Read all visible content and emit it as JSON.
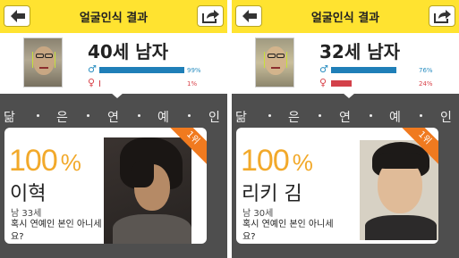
{
  "panels": [
    {
      "header": {
        "title": "얼굴인식 결과"
      },
      "profile": {
        "title": "40세 남자",
        "male_symbol": "♂",
        "female_symbol": "♀",
        "male_pct": "99%",
        "female_pct": "1%",
        "male_fraction": 0.99,
        "female_fraction": 0.01
      },
      "strip": {
        "title_chars": [
          "닮",
          "은",
          "연",
          "예",
          "인"
        ]
      },
      "card": {
        "percent": "100",
        "percent_unit": "%",
        "name": "이혁",
        "sub": "남 33세",
        "message": "혹시 연예인 본인 아니세요?",
        "rank": "1위"
      }
    },
    {
      "header": {
        "title": "얼굴인식 결과"
      },
      "profile": {
        "title": "32세 남자",
        "male_symbol": "♂",
        "female_symbol": "♀",
        "male_pct": "76%",
        "female_pct": "24%",
        "male_fraction": 0.76,
        "female_fraction": 0.24
      },
      "strip": {
        "title_chars": [
          "닮",
          "은",
          "연",
          "예",
          "인"
        ]
      },
      "card": {
        "percent": "100",
        "percent_unit": "%",
        "name": "리키 김",
        "sub": "남 30세",
        "message": "혹시 연예인 본인 아니세요?",
        "rank": "1위"
      }
    }
  ],
  "icons": {
    "back": "back-arrow-icon",
    "share": "share-icon"
  },
  "colors": {
    "header": "#ffe330",
    "accent": "#f2a92a",
    "male": "#1f7fb8",
    "female": "#d3414a",
    "ribbon": "#f07a1f",
    "strip": "#4e4e4e"
  }
}
